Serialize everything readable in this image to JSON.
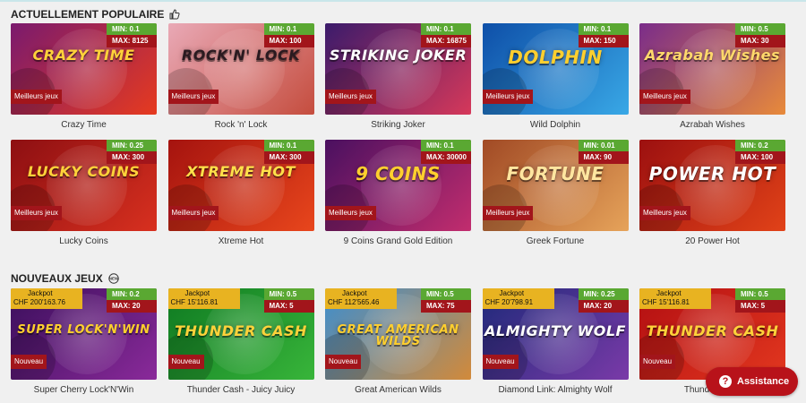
{
  "sections": [
    {
      "title": "ACTUELLEMENT POPULAIRE",
      "icon": "thumbs-up-icon"
    },
    {
      "title": "NOUVEAUX JEUX",
      "icon": "new-badge-icon"
    }
  ],
  "popular_games": [
    {
      "name": "Crazy Time",
      "art": "CRAZY TIME",
      "min": "MIN: 0.1",
      "max": "MAX: 8125",
      "badge": "Meilleurs jeux",
      "bg": "#7a1a6e",
      "bg2": "#e63a1f",
      "text_color": "#ffd23a"
    },
    {
      "name": "Rock 'n' Lock",
      "art": "ROCK'N' LOCK",
      "min": "MIN: 0.1",
      "max": "MAX: 100",
      "badge": "Meilleurs jeux",
      "bg": "#e9a9b6",
      "bg2": "#c54d3e",
      "text_color": "#2b1a20"
    },
    {
      "name": "Striking Joker",
      "art": "STRIKING JOKER",
      "min": "MIN: 0.1",
      "max": "MAX: 16875",
      "badge": "Meilleurs jeux",
      "bg": "#3b1b6b",
      "bg2": "#d6385a",
      "text_color": "#ffffff"
    },
    {
      "name": "Wild Dolphin",
      "art": "DOLPHIN",
      "min": "MIN: 0.1",
      "max": "MAX: 150",
      "badge": "Meilleurs jeux",
      "bg": "#0e4fa8",
      "bg2": "#39a8e6",
      "text_color": "#ffcf2e"
    },
    {
      "name": "Azrabah Wishes",
      "art": "Azrabah Wishes",
      "min": "MIN: 0.5",
      "max": "MAX: 30",
      "badge": "Meilleurs jeux",
      "bg": "#7a2c8a",
      "bg2": "#e88a3a",
      "text_color": "#ffd86b"
    },
    {
      "name": "Lucky Coins",
      "art": "LUCKY COINS",
      "min": "MIN: 0.25",
      "max": "MAX: 300",
      "badge": "Meilleurs jeux",
      "bg": "#8d0f12",
      "bg2": "#d8301f",
      "text_color": "#ffd23a"
    },
    {
      "name": "Xtreme Hot",
      "art": "XTREME HOT",
      "min": "MIN: 0.1",
      "max": "MAX: 300",
      "badge": "Meilleurs jeux",
      "bg": "#a5130f",
      "bg2": "#e8461c",
      "text_color": "#ffe04a"
    },
    {
      "name": "9 Coins Grand Gold Edition",
      "art": "9 COINS",
      "min": "MIN: 0.1",
      "max": "MAX: 30000",
      "badge": "Meilleurs jeux",
      "bg": "#4a1060",
      "bg2": "#c22d6e",
      "text_color": "#ffcf2e"
    },
    {
      "name": "Greek Fortune",
      "art": "FORTUNE",
      "min": "MIN: 0.01",
      "max": "MAX: 90",
      "badge": "Meilleurs jeux",
      "bg": "#a14a25",
      "bg2": "#e6a35a",
      "text_color": "#ffe6a0"
    },
    {
      "name": "20 Power Hot",
      "art": "POWER HOT",
      "min": "MIN: 0.2",
      "max": "MAX: 100",
      "badge": "Meilleurs jeux",
      "bg": "#9c1010",
      "bg2": "#e14218",
      "text_color": "#ffffff"
    }
  ],
  "new_games": [
    {
      "name": "Super Cherry Lock'N'Win",
      "art": "SUPER LOCK'N'WIN",
      "jackpot_label": "Jackpot",
      "jackpot_value": "CHF 200'163.76",
      "min": "MIN: 0.2",
      "max": "MAX: 20",
      "badge": "Nouveau",
      "bg": "#3b0f5c",
      "bg2": "#8a2a9a",
      "text_color": "#ffcf2e"
    },
    {
      "name": "Thunder Cash - Juicy Juicy",
      "art": "THUNDER CASH",
      "jackpot_label": "Jackpot",
      "jackpot_value": "CHF 15'116.81",
      "min": "MIN: 0.5",
      "max": "MAX: 5",
      "badge": "Nouveau",
      "bg": "#0f7a22",
      "bg2": "#38b53a",
      "text_color": "#ffd23a"
    },
    {
      "name": "Great American Wilds",
      "art": "GREAT AMERICAN WILDS",
      "jackpot_label": "Jackpot",
      "jackpot_value": "CHF 112'565.46",
      "min": "MIN: 0.5",
      "max": "MAX: 75",
      "badge": "Nouveau",
      "bg": "#3c8ed0",
      "bg2": "#d28a3a",
      "text_color": "#ffcf2e"
    },
    {
      "name": "Diamond Link: Almighty Wolf",
      "art": "ALMIGHTY WOLF",
      "jackpot_label": "Jackpot",
      "jackpot_value": "CHF 20'798.91",
      "min": "MIN: 0.25",
      "max": "MAX: 20",
      "badge": "Nouveau",
      "bg": "#1f2a7a",
      "bg2": "#7a3aa8",
      "text_color": "#ffffff"
    },
    {
      "name": "Thunder Cash",
      "art": "THUNDER CASH",
      "jackpot_label": "Jackpot",
      "jackpot_value": "CHF 15'116.81",
      "min": "MIN: 0.5",
      "max": "MAX: 5",
      "badge": "Nouveau",
      "bg": "#b30f12",
      "bg2": "#e2371f",
      "text_color": "#ffd23a"
    }
  ],
  "assistance": {
    "label": "Assistance",
    "icon": "question-icon"
  },
  "colors": {
    "accent_red": "#a2151b",
    "min_green": "#5aa832",
    "jackpot_yellow": "#e8b321"
  }
}
